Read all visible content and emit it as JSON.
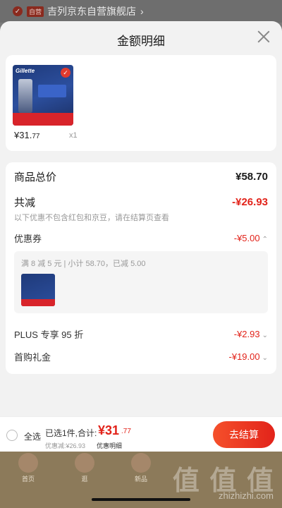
{
  "store": {
    "badge": "自营",
    "name": "吉列京东自营旗舰店",
    "chevron": "›"
  },
  "sheet": {
    "title": "金额明细",
    "product": {
      "price_main": "¥31.",
      "price_small": "77",
      "qty": "x1"
    },
    "goods_total_label": "商品总价",
    "goods_total_value": "¥58.70",
    "discount_label": "共减",
    "discount_value": "-¥26.93",
    "discount_note": "以下优惠不包含红包和京豆，请在结算页查看",
    "coupon_label": "优惠券",
    "coupon_value": "-¥5.00",
    "coupon_desc": "满 8 减 5 元 | 小计 58.70，已减 5.00",
    "plus_label": "PLUS 专享 95 折",
    "plus_value": "-¥2.93",
    "first_label": "首购礼金",
    "first_value": "-¥19.00"
  },
  "checkout": {
    "select_all": "全选",
    "selected_text": "已选1件,合计:",
    "total_main": "¥31",
    "total_small": ".77",
    "saved_text": "优惠减:¥26.93",
    "detail_link": "优惠明细",
    "pay_label": "去结算"
  },
  "nav": {
    "items": [
      {
        "label": "首页"
      },
      {
        "label": "逛"
      },
      {
        "label": "新品"
      }
    ]
  },
  "watermark": {
    "text": "值 值 值",
    "url": "zhizhizhi.com"
  },
  "colors": {
    "accent": "#e2231a",
    "sheet_bg": "#f2f2f2"
  }
}
